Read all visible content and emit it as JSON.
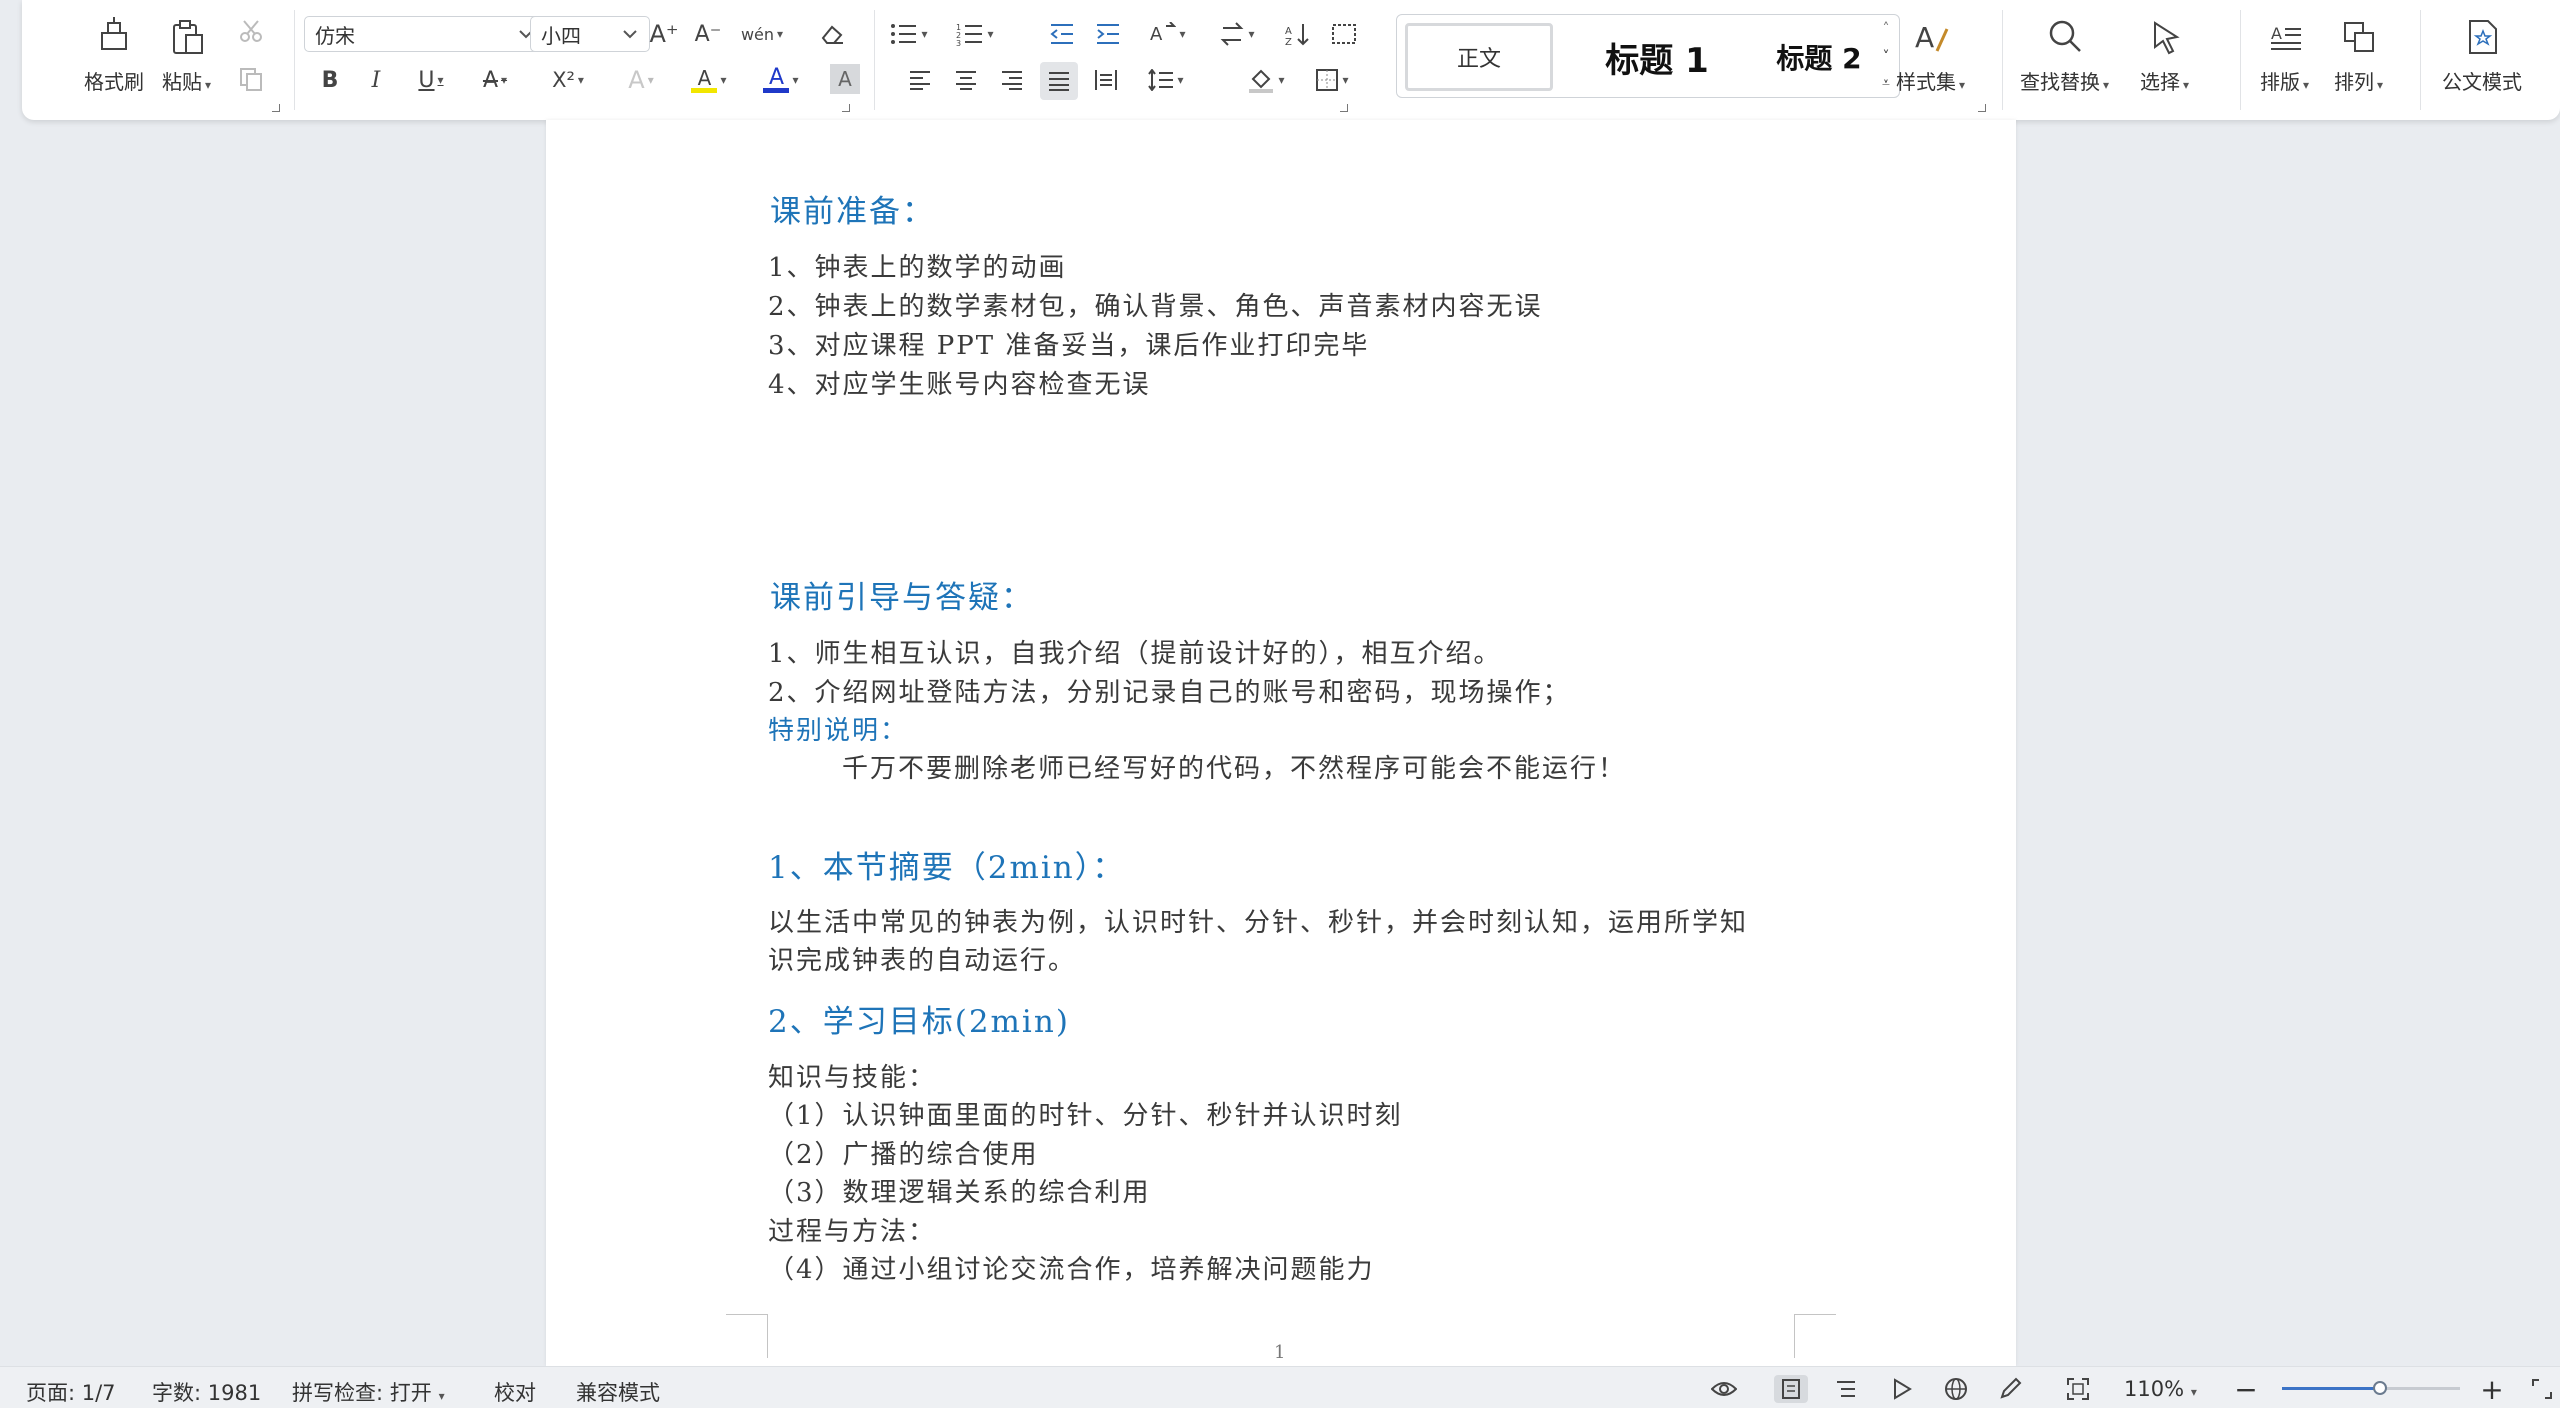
{
  "ribbon": {
    "format_painter": "格式刷",
    "paste": "粘贴",
    "font_name": "仿宋",
    "font_size": "小四",
    "bold": "B",
    "italic": "I",
    "underline": "U",
    "superscript": "X²",
    "font_color_letter": "A",
    "highlight_letter": "A",
    "char_shading_letter": "A",
    "grow_font": "A⁺",
    "shrink_font": "A⁻",
    "phonetic": "wén",
    "styles": {
      "normal": "正文",
      "heading1": "标题 1",
      "heading2": "标题 2"
    },
    "style_set": "样式集",
    "find_replace": "查找替换",
    "select": "选择",
    "typeset": "排版",
    "arrange": "排列",
    "official_mode": "公文模式",
    "colors": {
      "font_color_bar": "#1f39c9",
      "highlight_bar": "#f2e600"
    }
  },
  "document": {
    "prep_heading": "课前准备：",
    "prep_items": [
      "1、钟表上的数学的动画",
      "2、钟表上的数学素材包，确认背景、角色、声音素材内容无误",
      "3、对应课程 PPT 准备妥当，课后作业打印完毕",
      "4、对应学生账号内容检查无误"
    ],
    "guide_heading": "课前引导与答疑：",
    "guide_items": [
      "1、师生相互认识，自我介绍（提前设计好的），相互介绍。",
      "2、介绍网址登陆方法，分别记录自己的账号和密码，现场操作；"
    ],
    "special_label": "特别说明：",
    "special_text": "千万不要删除老师已经写好的代码，不然程序可能会不能运行！",
    "summary_heading": "1、本节摘要（2min）：",
    "summary_line1": "以生活中常见的钟表为例，认识时针、分针、秒针，并会时刻认知，运用所学知",
    "summary_line2": "识完成钟表的自动运行。",
    "goals_heading": "2、学习目标(2min)",
    "knowledge_label": "知识与技能：",
    "goal_items": [
      "（1）认识钟面里面的时针、分针、秒针并认识时刻",
      "（2）广播的综合使用",
      "（3）数理逻辑关系的综合利用"
    ],
    "process_label": "过程与方法：",
    "process_item": "（4）通过小组讨论交流合作，培养解决问题能力",
    "page_number": "1"
  },
  "status": {
    "page": "页面: 1/7",
    "word_count": "字数: 1981",
    "spell_check": "拼写检查: 打开",
    "proofread": "校对",
    "compat_mode": "兼容模式",
    "zoom": "110%",
    "zoom_fraction": 0.55
  }
}
